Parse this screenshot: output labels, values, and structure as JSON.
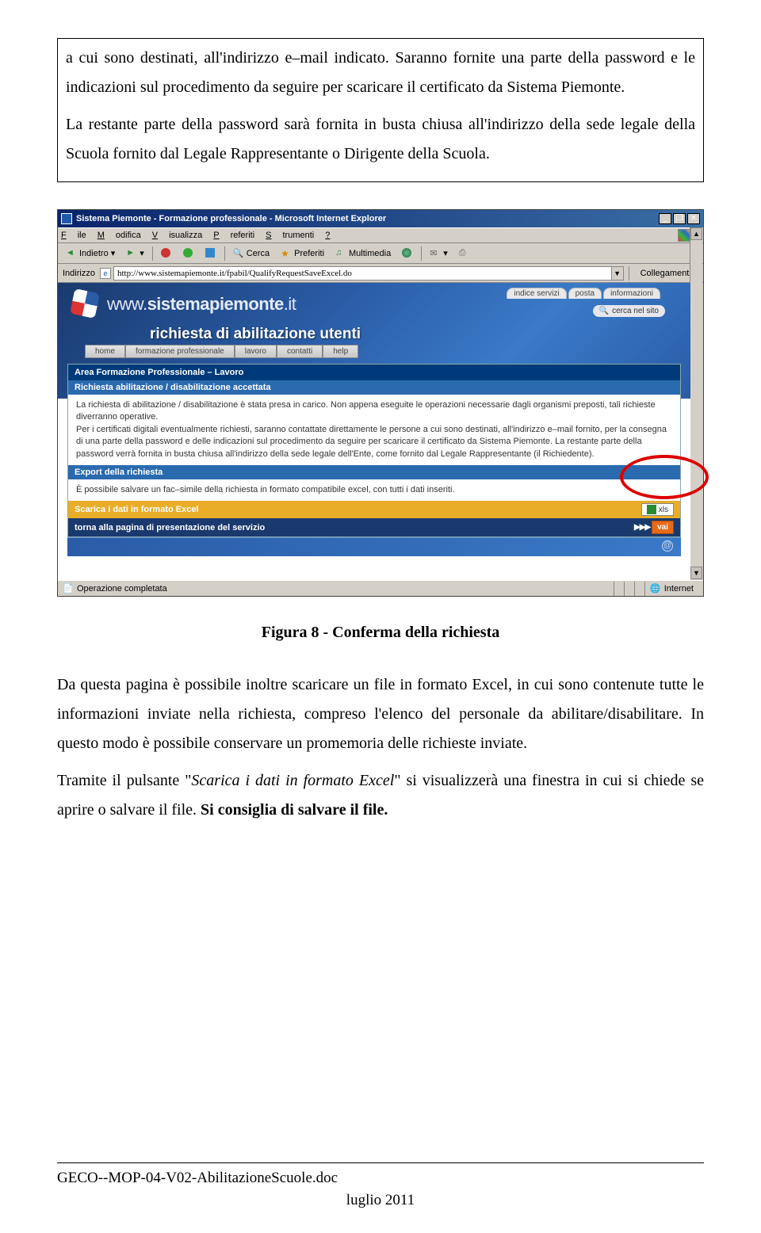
{
  "doc": {
    "para1_a": "a cui sono destinati, all'indirizzo e–mail indicato. Saranno fornite una parte della password e le indicazioni sul procedimento da seguire per scaricare il certificato da Sistema Piemonte.",
    "para1_b": "La restante parte della password sarà fornita in busta chiusa all'indirizzo della sede legale della Scuola fornito dal Legale Rappresentante o Dirigente della Scuola.",
    "caption": "Figura 8  - Conferma della richiesta",
    "p2": "Da questa pagina è possibile inoltre scaricare un file in formato Excel, in cui sono contenute tutte le informazioni inviate nella richiesta, compreso l'elenco del personale da abilitare/disabilitare. In questo modo è possibile conservare un promemoria delle richieste inviate.",
    "p3_a": "Tramite il pulsante \"",
    "p3_i": "Scarica i dati in formato Excel",
    "p3_b": "\" si visualizzerà una finestra in cui si chiede se aprire o salvare il file. ",
    "p3_bold": "Si consiglia di salvare il file.",
    "footer_doc": "GECO--MOP-04-V02-AbilitazioneScuole.doc",
    "footer_date": "luglio 2011"
  },
  "ie": {
    "title": "Sistema Piemonte - Formazione professionale - Microsoft Internet Explorer",
    "menu": [
      "File",
      "Modifica",
      "Visualizza",
      "Preferiti",
      "Strumenti",
      "?"
    ],
    "back": "Indietro",
    "cerca": "Cerca",
    "preferiti": "Preferiti",
    "multimedia": "Multimedia",
    "addr_label": "Indirizzo",
    "addr_value": "http://www.sistemapiemonte.it/fpabil/QualifyRequestSaveExcel.do",
    "links": "Collegamenti",
    "status_left": "Operazione completata",
    "status_right": "Internet",
    "win_min": "_",
    "win_max": "❐",
    "win_close": "✕"
  },
  "page": {
    "tabs": [
      "indice servizi",
      "posta",
      "informazioni"
    ],
    "domain_1": "www.",
    "domain_2": "sistemapiemonte",
    "domain_3": ".it",
    "search": "cerca nel sito",
    "bigtitle": "richiesta di abilitazione utenti",
    "secnav": [
      "home",
      "formazione professionale",
      "lavoro",
      "contatti",
      "help"
    ],
    "band1": "Area Formazione Professionale – Lavoro",
    "band2": "Richiesta abilitazione / disabilitazione accettata",
    "text1": "La richiesta di abilitazione / disabilitazione è stata presa in carico. Non appena eseguite le operazioni necessarie dagli organismi preposti, tali richieste diverranno operative.\nPer i certificati digitali eventualmente richiesti, saranno contattate direttamente le persone a cui sono destinati, all'indirizzo e–mail fornito, per la consegna di una parte della password e delle indicazioni sul procedimento da seguire per scaricare il certificato da Sistema Piemonte. La restante parte della password verrà fornita in busta chiusa all'indirizzo della sede legale dell'Ente, come fornito dal Legale Rappresentante (il Richiedente).",
    "band3": "Export della richiesta",
    "text2": "È possibile salvare un fac–simile della richiesta in formato compatibile excel, con tutti i dati inseriti.",
    "band4": "Scarica i dati in formato Excel",
    "xls": "xls",
    "band5": "torna alla pagina di presentazione del servizio",
    "vai": "vai",
    "vai_arrows": "▶▶▶"
  }
}
